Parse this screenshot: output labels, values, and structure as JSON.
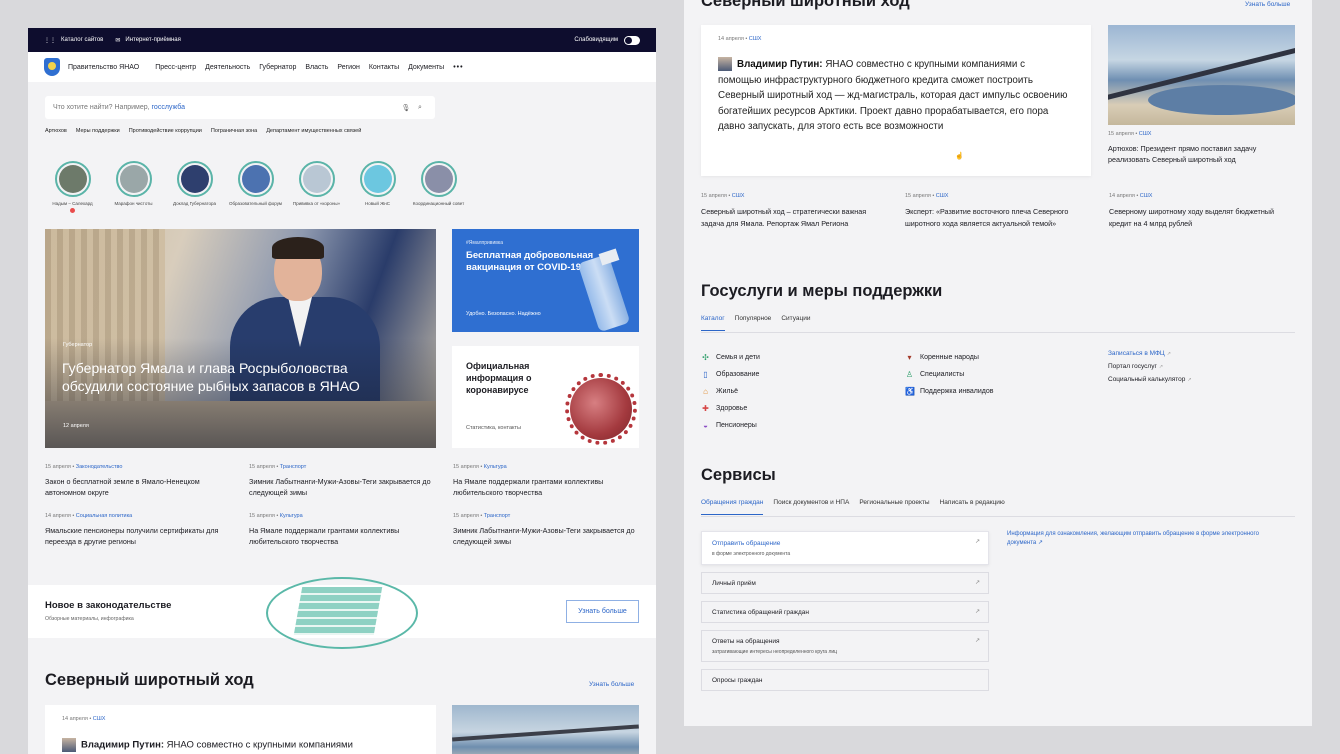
{
  "left": {
    "topbar": {
      "catalog": "Каталог сайтов",
      "reception": "Интернет-приёмная",
      "low_vision": "Слабовидящим"
    },
    "nav": {
      "brand": "Правительство ЯНАО",
      "items": [
        "Пресс-центр",
        "Деятельность",
        "Губернатор",
        "Власть",
        "Регион",
        "Контакты",
        "Документы"
      ],
      "more": "•••"
    },
    "search": {
      "placeholder": "Что хотите найти? Например, ",
      "example": "госслужба"
    },
    "chips": [
      "Артюхов",
      "Меры поддержки",
      "Противодействие коррупции",
      "Пограничная зона",
      "Департамент имущественных связей"
    ],
    "stories": [
      {
        "label": "Надым – Салехард",
        "color": "#6d7a6a"
      },
      {
        "label": "Марафон чистоты",
        "color": "#9aa7a8"
      },
      {
        "label": "Доклад Губернатора",
        "color": "#2e3f6e"
      },
      {
        "label": "Образовательный форум",
        "color": "#4c72b0"
      },
      {
        "label": "Прививка от «короны»",
        "color": "#b9c7d4"
      },
      {
        "label": "Новый ЖнС",
        "color": "#6cc7e0"
      },
      {
        "label": "Координационный совет",
        "color": "#8a8fa8"
      }
    ],
    "hero": {
      "tag": "Губернатор",
      "title": "Губернатор Ямала и глава Росрыболовства обсудили состояние рыбных запасов в ЯНАО",
      "date": "12 апреля"
    },
    "vaccine_card": {
      "tag": "#Ямалпрививка",
      "title": "Бесплатная добровольная вакцинация от COVID-19",
      "footer": "Удобно. Безопасно. Надёжно"
    },
    "covid_card": {
      "title": "Официальная информация о коронавирусе",
      "footer": "Статистика, контакты"
    },
    "news": [
      {
        "date": "15 апреля",
        "cat": "Законодательство",
        "title": "Закон о бесплатной земле в Ямало-Ненецком автономном округе"
      },
      {
        "date": "15 апреля",
        "cat": "Транспорт",
        "title": "Зимник Лабытнанги-Мужи-Азовы-Теги закрывается до следующей зимы"
      },
      {
        "date": "15 апреля",
        "cat": "Культура",
        "title": "На Ямале поддержали грантами коллективы любительского творчества"
      },
      {
        "date": "14 апреля",
        "cat": "Социальная политика",
        "title": "Ямальские пенсионеры получили сертификаты для переезда в другие регионы"
      },
      {
        "date": "15 апреля",
        "cat": "Культура",
        "title": "На Ямале поддержали грантами коллективы любительского творчества"
      },
      {
        "date": "15 апреля",
        "cat": "Транспорт",
        "title": "Зимник Лабытнанги-Мужи-Азовы-Теги закрывается до следующей зимы"
      }
    ],
    "law": {
      "title": "Новое в законодательстве",
      "subtitle": "Обзорные материалы, инфографика",
      "button": "Узнать больше"
    },
    "section": {
      "title": "Северный широтный ход",
      "more": "Узнать больше",
      "date": "14 апреля",
      "cat": "СШХ",
      "quote_author": "Владимир Путин:",
      "quote_start": "ЯНАО совместно с  крупными компаниями"
    }
  },
  "right": {
    "section": {
      "title": "Северный широтный ход",
      "more": "Узнать больше"
    },
    "main_card": {
      "date": "14 апреля",
      "cat": "СШХ",
      "author": "Владимир Путин:",
      "text": "ЯНАО совместно с  крупными компаниями с помощью инфраструктурного бюджетного кредита сможет построить Северный широтный ход — жд-магистраль, которая даст импульс освоению богатейших ресурсов Арктики. Проект давно прорабатывается, его пора давно запускать, для этого есть все возможности"
    },
    "side_news": {
      "date": "15 апреля",
      "cat": "СШХ",
      "title": "Артюхов: Президент прямо поставил задачу реализовать Северный широтный ход"
    },
    "news": [
      {
        "date": "15 апреля",
        "cat": "СШХ",
        "title": "Северный широтный ход – стратегически важная задача для Ямала. Репортаж Ямал Региона"
      },
      {
        "date": "15 апреля",
        "cat": "СШХ",
        "title": "Эксперт: «Развитие восточного плеча Северного широтного хода является актуальной темой»"
      },
      {
        "date": "14 апреля",
        "cat": "СШХ",
        "title": "Северному широтному ходу выделят бюджетный кредит на 4 млрд рублей"
      }
    ],
    "gos": {
      "title": "Госуслуги и меры поддержки",
      "tabs": [
        "Каталог",
        "Популярное",
        "Ситуации"
      ],
      "col1": [
        {
          "icon": "✣",
          "color": "#2e9e6a",
          "label": "Семья и дети"
        },
        {
          "icon": "▯",
          "color": "#2c66c8",
          "label": "Образование"
        },
        {
          "icon": "⌂",
          "color": "#e08a2a",
          "label": "Жильё"
        },
        {
          "icon": "✚",
          "color": "#d64545",
          "label": "Здоровье"
        },
        {
          "icon": "◒",
          "color": "#8a4cc4",
          "label": "Пенсионеры"
        }
      ],
      "col2": [
        {
          "icon": "▾",
          "color": "#a33a2a",
          "label": "Коренные народы"
        },
        {
          "icon": "♙",
          "color": "#2e9e6a",
          "label": "Специалисты"
        },
        {
          "icon": "♿",
          "color": "#2c66c8",
          "label": "Поддержка инвалидов"
        }
      ],
      "col3": [
        {
          "label": "Записаться в МФЦ",
          "ext": "↗"
        },
        {
          "label": "Портал госуслуг",
          "ext": "↗"
        },
        {
          "label": "Социальный калькулятор",
          "ext": "↗"
        }
      ]
    },
    "services": {
      "title": "Сервисы",
      "tabs": [
        "Обращения граждан",
        "Поиск документов и НПА",
        "Региональные проекты",
        "Написать в редакцию"
      ],
      "items": [
        {
          "label": "Отправить обращение",
          "sub": "в форме электронного документа"
        },
        {
          "label": "Личный приём",
          "sub": ""
        },
        {
          "label": "Статистика обращений граждан",
          "sub": ""
        },
        {
          "label": "Ответы на обращения",
          "sub": "затрагивающие интересы неопределенного круга лиц"
        },
        {
          "label": "Опросы граждан",
          "sub": ""
        }
      ],
      "info": "Информация для ознакомления, желающим отправить обращение в форме электронного документа ↗"
    }
  }
}
